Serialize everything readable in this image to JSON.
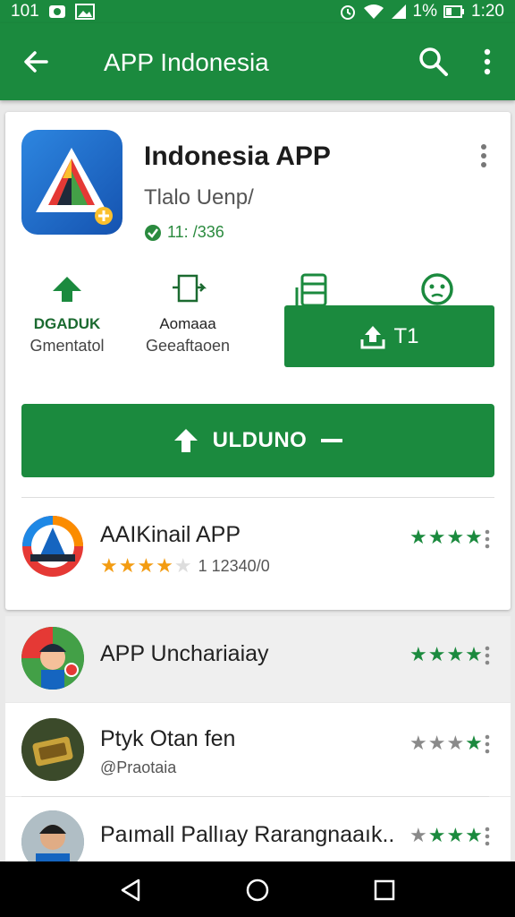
{
  "status_bar": {
    "left_text": "101",
    "battery_text": "1%",
    "time": "1:20"
  },
  "app_bar": {
    "title": "APP Indonesia"
  },
  "app": {
    "name": "Indonesia APP",
    "developer": "Tlalo Uenp/",
    "meta": "11: /336"
  },
  "stats": [
    {
      "value": "DGADUK",
      "label": "Gmentatol"
    },
    {
      "value": "Aomaaa",
      "label": "Geeaftaoen"
    }
  ],
  "small_button": {
    "label": "T1"
  },
  "install_button": {
    "label": "ULDUNO"
  },
  "related": [
    {
      "title": "AAIKinail APP",
      "rating_text": "1 12340/0",
      "stars": "★★★★"
    },
    {
      "title": "APP Unchariaiay",
      "stars": "★★★★"
    },
    {
      "title": "Ptyk Otan fen",
      "subtitle": "@Praotaia",
      "stars": "★★★★"
    },
    {
      "title": "Paımall Pallıay Rarangnaaık..",
      "stars": "★★★★"
    }
  ],
  "colors": {
    "primary": "#1b8a3e",
    "star_green": "#1b8a3e",
    "star_orange": "#f39c12",
    "star_gray": "#8a8a8a"
  }
}
